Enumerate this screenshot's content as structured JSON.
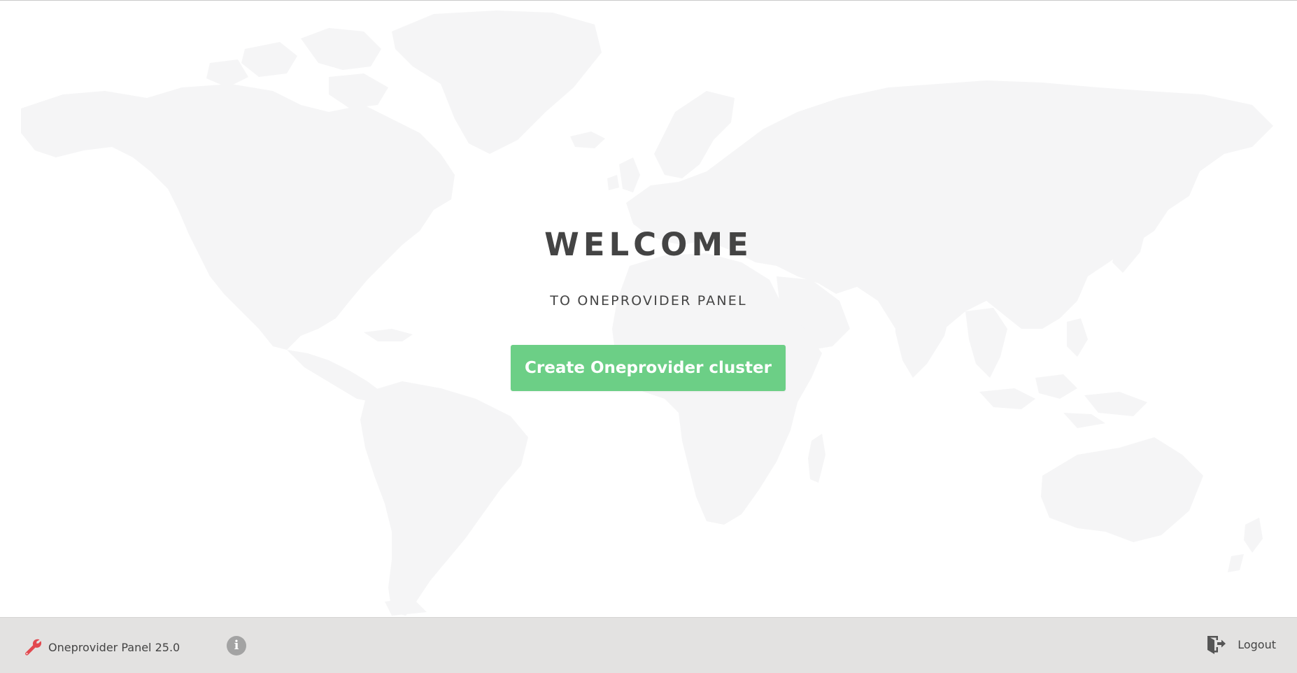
{
  "welcome": {
    "title": "WELCOME",
    "subtitle": "TO ONEPROVIDER PANEL"
  },
  "actions": {
    "create_cluster_label": "Create Oneprovider cluster"
  },
  "footer": {
    "app_version": "Oneprovider Panel 25.0",
    "info_icon_label": "i",
    "logout_label": "Logout"
  },
  "icons": {
    "brand": "wrench-icon",
    "info": "info-icon",
    "logout": "logout-icon"
  },
  "colors": {
    "primary_button": "#6ccf86",
    "footer_background": "#e3e2e1",
    "text_dark": "#444444",
    "map_land": "#f5f5f6",
    "wrench_red": "#e2484e",
    "info_gray": "#a3a3a3"
  }
}
